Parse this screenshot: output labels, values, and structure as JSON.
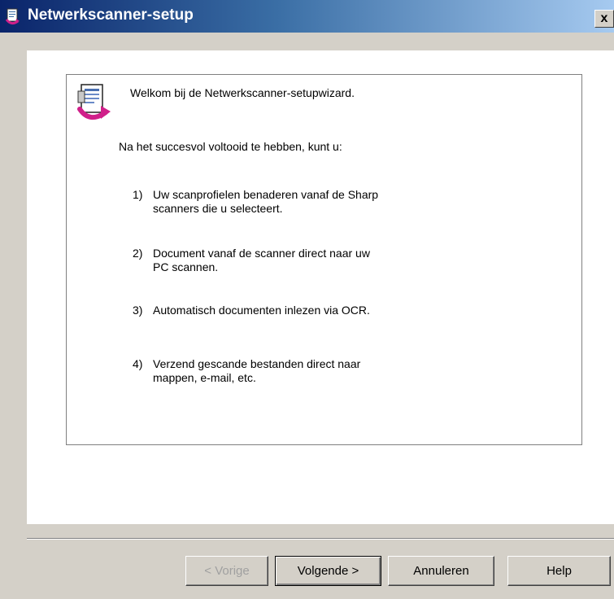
{
  "window": {
    "title": "Netwerkscanner-setup",
    "close_glyph": "x"
  },
  "wizard": {
    "welcome": "Welkom bij de Netwerkscanner-setupwizard.",
    "intro": "Na het succesvol voltooid te hebben, kunt u:",
    "items": [
      {
        "num": "1)",
        "text": "Uw scanprofielen benaderen vanaf de Sharp\nscanners die u selecteert."
      },
      {
        "num": "2)",
        "text": "Document vanaf de scanner direct naar uw\nPC scannen."
      },
      {
        "num": "3)",
        "text": "Automatisch documenten inlezen via OCR."
      },
      {
        "num": "4)",
        "text": "Verzend gescande bestanden direct naar\nmappen, e-mail, etc."
      }
    ]
  },
  "buttons": {
    "back": "< Vorige",
    "next": "Volgende >",
    "cancel": "Annuleren",
    "help": "Help"
  },
  "icons": {
    "app": "scanner-setup-icon",
    "wizard": "wizard-document-icon"
  },
  "colors": {
    "titlebar_start": "#0a246a",
    "titlebar_end": "#a6caf0",
    "dialog_bg": "#d4d0c8",
    "panel_bg": "#ffffff"
  }
}
